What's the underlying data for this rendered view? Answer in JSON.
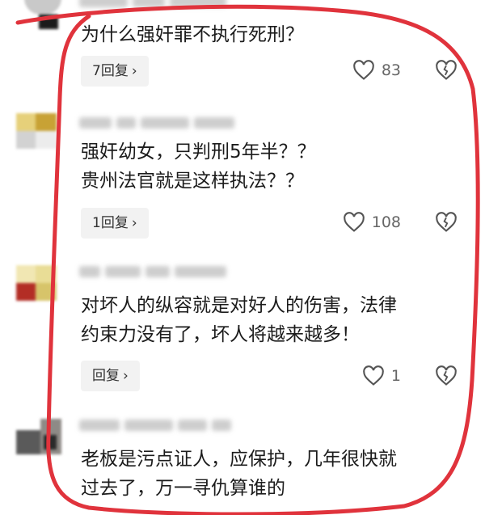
{
  "comments": [
    {
      "text": "为什么强奸罪不执行死刑？",
      "reply": {
        "label": "7回复",
        "chevron": "›"
      },
      "likes": "83"
    },
    {
      "text": "强奸幼女，只判刑5年半？？\n贵州法官就是这样执法？？",
      "reply": {
        "label": "1回复",
        "chevron": "›"
      },
      "likes": "108"
    },
    {
      "text": "对坏人的纵容就是对好人的伤害，法律\n约束力没有了，坏人将越来越多！",
      "reply": {
        "label": "回复",
        "chevron": "›"
      },
      "likes": "1"
    },
    {
      "text": "老板是污点证人，应保护，几年很快就\n过去了，万一寻仇算谁的"
    }
  ],
  "icons": {
    "like": "heart-outline-icon",
    "dislike": "broken-heart-icon"
  },
  "colors": {
    "annotation_oval": "#e0333c",
    "reply_bg": "#f2f2f2",
    "text": "#1c1c1c",
    "meta": "#666666"
  }
}
